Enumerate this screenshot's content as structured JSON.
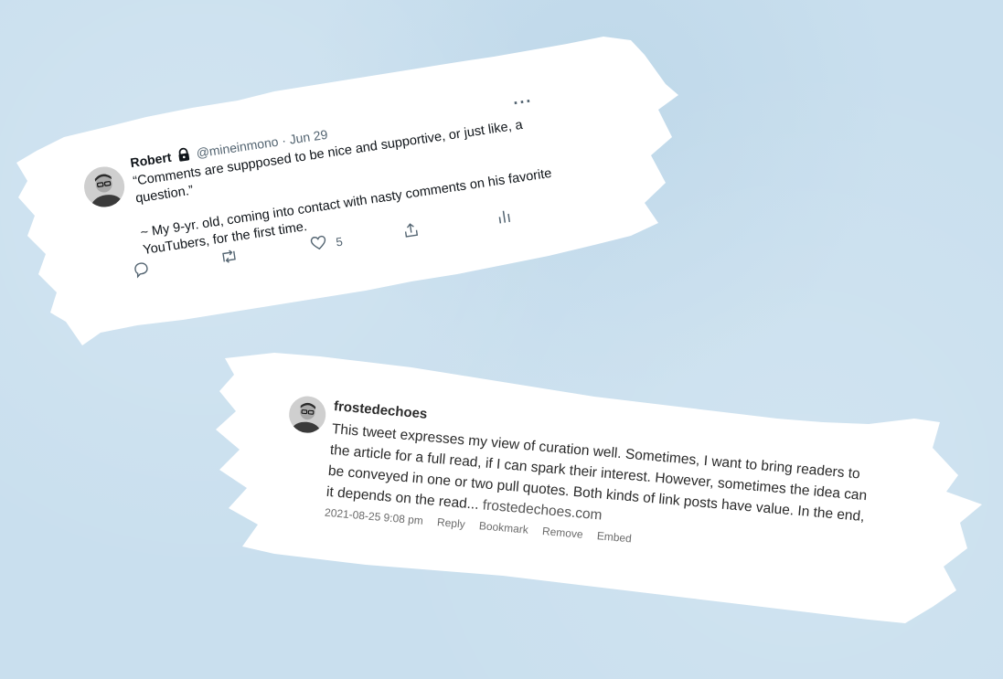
{
  "tweet": {
    "name": "Robert",
    "handle": "@mineinmono",
    "separator": "·",
    "date": "Jun 29",
    "more": "···",
    "paragraph1": "“Comments are suppposed to be nice and supportive, or just like, a question.”",
    "paragraph2": "~ My 9-yr. old, coming into contact with nasty comments on his favorite YouTubers, for the first time.",
    "likes": "5",
    "icons": [
      "lock-icon",
      "more-icon",
      "reply-icon",
      "retweet-icon",
      "like-icon",
      "share-icon",
      "analytics-icon"
    ]
  },
  "comment": {
    "author": "frostedechoes",
    "text": "This tweet expresses my view of curation well. Sometimes, I want to bring readers to the article for a full read, if I can spark their interest. However, sometimes the idea can be conveyed in one or two pull quotes. Both kinds of link posts have value. In the end, it depends on the read...",
    "link": "frostedechoes.com",
    "timestamp": "2021-08-25 9:08 pm",
    "actions": {
      "reply": "Reply",
      "bookmark": "Bookmark",
      "remove": "Remove",
      "embed": "Embed"
    }
  },
  "colors": {
    "background": "#c9dfee",
    "paper": "#ffffff",
    "text": "#0f1419",
    "muted": "#536471"
  }
}
